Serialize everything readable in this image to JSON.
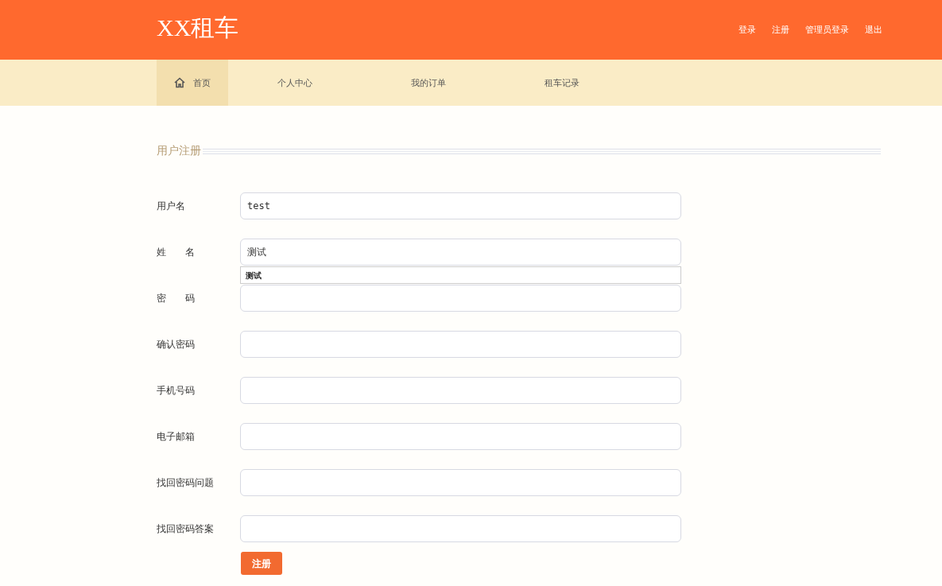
{
  "header": {
    "logo": "XX租车",
    "links": [
      "登录",
      "注册",
      "管理员登录",
      "退出"
    ]
  },
  "nav": [
    {
      "label": "首页",
      "selected": true
    },
    {
      "label": "个人中心",
      "selected": false
    },
    {
      "label": "我的订单",
      "selected": false
    },
    {
      "label": "租车记录",
      "selected": false
    }
  ],
  "section_title": "用户注册",
  "fields": [
    {
      "label": "用户名",
      "value": "test"
    },
    {
      "label": "姓　　名",
      "value": "测试",
      "suggestion": "测试"
    },
    {
      "label": "密　　码"
    },
    {
      "label": "确认密码"
    },
    {
      "label": "手机号码"
    },
    {
      "label": "电子邮箱"
    },
    {
      "label": "找回密码问题"
    },
    {
      "label": "找回密码答案"
    }
  ],
  "submit": "注册"
}
